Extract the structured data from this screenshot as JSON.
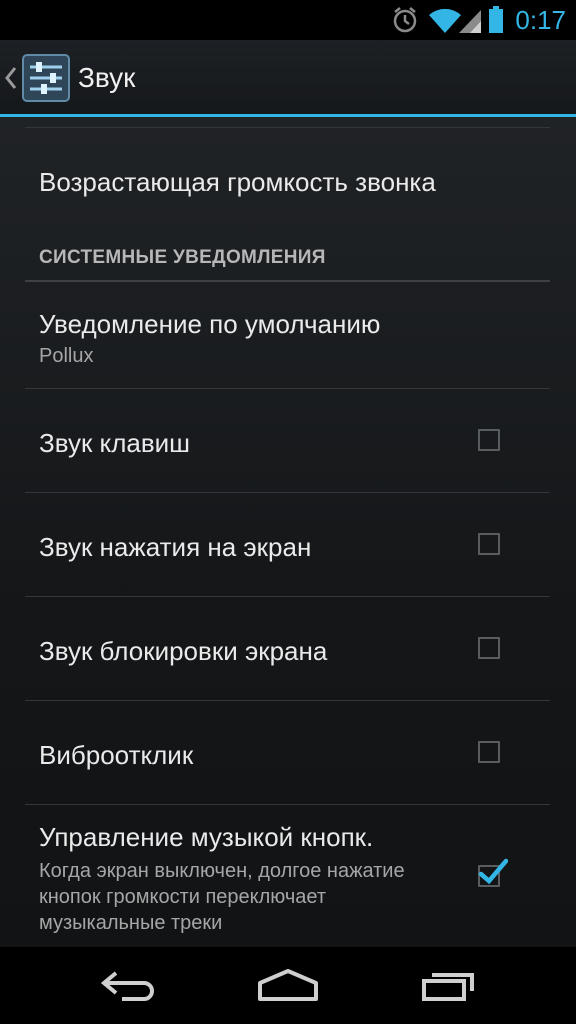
{
  "status_bar": {
    "time": "0:17",
    "icons": [
      "alarm-icon",
      "wifi-icon",
      "signal-icon",
      "battery-icon"
    ],
    "accent_color": "#33b5e5"
  },
  "action_bar": {
    "title": "Звук",
    "icon": "sound-settings-icon"
  },
  "preferences": {
    "ascending_ringtone": {
      "title": "Возрастающая громкость звонка"
    },
    "category_system": "СИСТЕМНЫЕ УВЕДОМЛЕНИЯ",
    "default_notification": {
      "title": "Уведомление по умолчанию",
      "summary": "Pollux"
    },
    "key_sounds": {
      "title": "Звук клавиш",
      "checked": false
    },
    "touch_sounds": {
      "title": "Звук нажатия на экран",
      "checked": false
    },
    "lock_sounds": {
      "title": "Звук блокировки экрана",
      "checked": false
    },
    "vibrate_on_touch": {
      "title": "Виброотклик",
      "checked": false
    },
    "music_control": {
      "title": "Управление музыкой кнопк.",
      "summary": "Когда экран выключен, долгое нажатие кнопок громкости переключает музыкальные треки",
      "checked": true
    }
  },
  "nav_bar": {
    "buttons": [
      "back-icon",
      "home-icon",
      "recent-apps-icon"
    ]
  }
}
